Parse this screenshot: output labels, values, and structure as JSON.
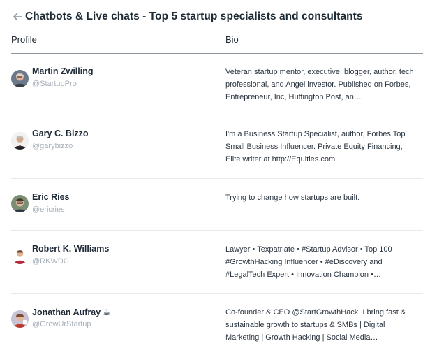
{
  "header": {
    "back_icon": "arrow-left-icon",
    "title": "Chatbots & Live chats - Top 5 startup specialists and consultants"
  },
  "columns": {
    "profile": "Profile",
    "bio": "Bio"
  },
  "rows": [
    {
      "name": "Martin Zwilling",
      "handle": "@StartupPro",
      "bio": "Veteran startup mentor, executive, blogger, author, tech professional, and Angel investor. Published on Forbes, Entrepreneur, Inc, Huffington Post, an…"
    },
    {
      "name": "Gary C. Bizzo",
      "handle": "@garybizzo",
      "bio": "I'm a Business Startup Specialist, author, Forbes Top Small Business Influencer. Private Equity Financing, Elite writer at http://Equities.com"
    },
    {
      "name": "Eric Ries",
      "handle": "@ericries",
      "bio": "Trying to change how startups are built."
    },
    {
      "name": "Robert K. Williams",
      "handle": "@RKWDC",
      "bio": "Lawyer • Texpatriate • #Startup Advisor • Top 100 #GrowthHacking Influencer • #eDiscovery and #LegalTech Expert • Innovation Champion •…"
    },
    {
      "name": "Jonathan Aufray",
      "emoji": "☕",
      "handle": "@GrowUrStartup",
      "bio": "Co-founder & CEO @StartGrowthHack. I bring fast & sustainable growth to startups & SMBs | Digital Marketing | Growth Hacking | Social Media…"
    }
  ]
}
